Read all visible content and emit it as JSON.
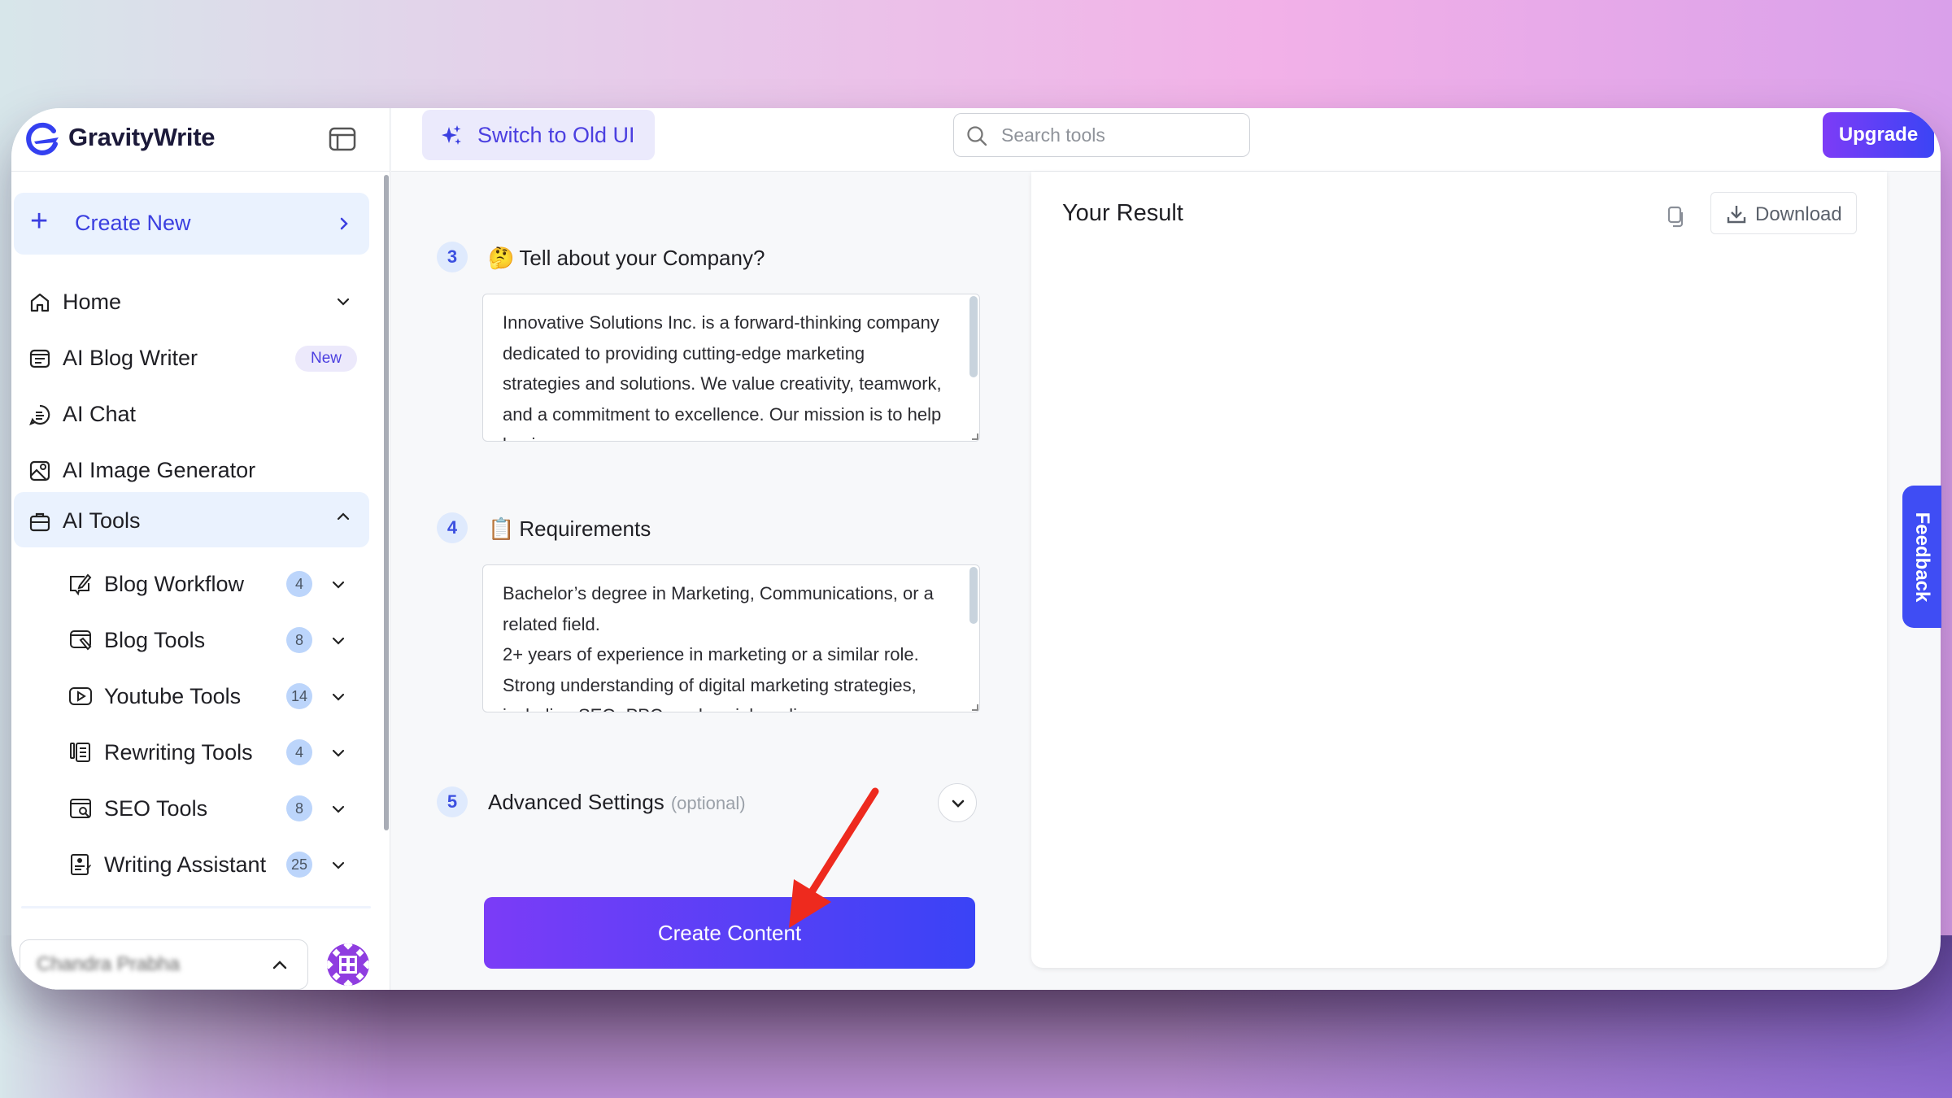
{
  "app": {
    "brand_name": "GravityWrite",
    "accent_color": "#3b3fe0"
  },
  "topbar": {
    "switch_ui_label": "Switch to Old UI",
    "search_placeholder": "Search tools",
    "search_value": "",
    "upgrade_label": "Upgrade"
  },
  "sidebar": {
    "create_new_label": "Create New",
    "items": [
      {
        "label": "Home",
        "icon": "home-icon",
        "expand": "chevron-down"
      },
      {
        "label": "AI Blog Writer",
        "icon": "blog-writer-icon",
        "badge": "New"
      },
      {
        "label": "AI Chat",
        "icon": "chat-icon"
      },
      {
        "label": "AI Image Generator",
        "icon": "image-icon"
      },
      {
        "label": "AI Tools",
        "icon": "briefcase-icon",
        "expand": "chevron-up",
        "active": true
      }
    ],
    "sub_items": [
      {
        "label": "Blog Workflow",
        "icon": "edit-window-icon",
        "count": "4"
      },
      {
        "label": "Blog Tools",
        "icon": "blog-tools-icon",
        "count": "8"
      },
      {
        "label": "Youtube Tools",
        "icon": "youtube-icon",
        "count": "14"
      },
      {
        "label": "Rewriting Tools",
        "icon": "rewrite-icon",
        "count": "4"
      },
      {
        "label": "SEO Tools",
        "icon": "seo-icon",
        "count": "8"
      },
      {
        "label": "Writing Assistant",
        "icon": "writing-assistant-icon",
        "count": "25"
      }
    ],
    "user_name": "Chandra Prabha"
  },
  "form": {
    "steps": [
      {
        "number": "3",
        "emoji": "🤔",
        "title": "Tell about your Company?",
        "value": "Innovative Solutions Inc. is a forward-thinking company dedicated to providing cutting-edge marketing strategies and solutions. We value creativity, teamwork, and a commitment to excellence. Our mission is to help businesses grow"
      },
      {
        "number": "4",
        "emoji": "📋",
        "title": "Requirements",
        "value": "Bachelor’s degree in Marketing, Communications, or a related field.\n2+ years of experience in marketing or a similar role.\nStrong understanding of digital marketing strategies, including SEO, PPC, and social media"
      },
      {
        "number": "5",
        "title": "Advanced Settings",
        "optional_label": "(optional)"
      }
    ],
    "create_button_label": "Create Content"
  },
  "result": {
    "title": "Your Result",
    "download_label": "Download"
  },
  "feedback_label": "Feedback"
}
